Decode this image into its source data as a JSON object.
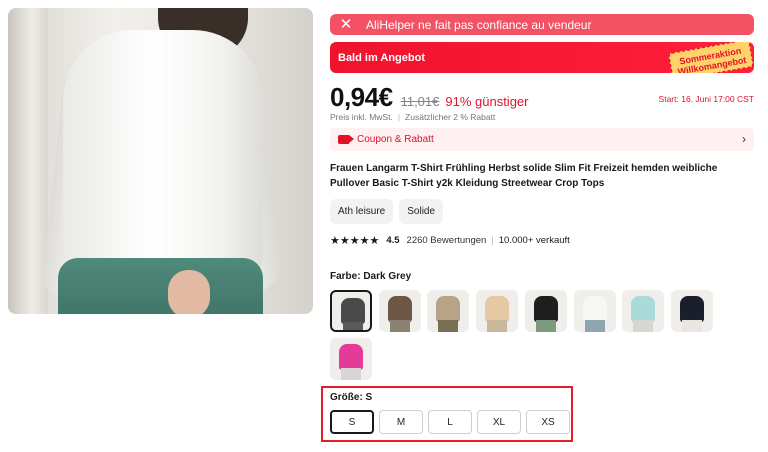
{
  "warning": {
    "icon": "close-icon",
    "text": "AliHelper ne fait pas confiance au vendeur",
    "color": "#f25264"
  },
  "deal": {
    "text": "Bald im Angebot",
    "badge": "Sommeraktion Willkomangebot",
    "color": "#f0132e"
  },
  "price": {
    "current": "0,94€",
    "original": "11,01€",
    "discount": "91% günstiger",
    "start": "Start: 16. Juni 17:00 CST"
  },
  "tax": {
    "incl": "Preis inkl. MwSt.",
    "extra": "Zusätzlicher 2 % Rabatt"
  },
  "coupon": {
    "icon": "tag-icon",
    "text": "Coupon & Rabatt",
    "chevron": "chevron-right-icon"
  },
  "product": {
    "title": "Frauen Langarm T-Shirt Frühling Herbst solide Slim Fit Freizeit hemden weibliche Pullover Basic T-Shirt y2k Kleidung Streetwear Crop Tops"
  },
  "chips": [
    "Ath leisure",
    "Solide"
  ],
  "rating": {
    "stars": 4.5,
    "stars_display": "★★★★★",
    "score": "4.5",
    "reviews": "2260 Bewertungen",
    "sold": "10.000+ verkauft"
  },
  "color": {
    "label": "Farbe: Dark Grey",
    "selected": 0,
    "swatches": [
      {
        "name": "Dark Grey",
        "shirt": "#4a4a4a",
        "pants": "#5a5a5a"
      },
      {
        "name": "Brown",
        "shirt": "#6e5646",
        "pants": "#8a8270"
      },
      {
        "name": "Khaki",
        "shirt": "#b7a487",
        "pants": "#7a6e55"
      },
      {
        "name": "Apricot",
        "shirt": "#e6c9a2",
        "pants": "#c9b79b"
      },
      {
        "name": "Black",
        "shirt": "#1e1e1e",
        "pants": "#7d9a7c"
      },
      {
        "name": "White",
        "shirt": "#f6f6f4",
        "pants": "#8fa6b0"
      },
      {
        "name": "Mint",
        "shirt": "#a9dcd8",
        "pants": "#d8d6d2"
      },
      {
        "name": "Navy",
        "shirt": "#1a1f2b",
        "pants": "#e9e6e0"
      },
      {
        "name": "Rose",
        "shirt": "#e63a9a",
        "pants": "#d9d5d5"
      }
    ]
  },
  "size": {
    "label": "Größe: S",
    "options": [
      "S",
      "M",
      "L",
      "XL",
      "XS"
    ],
    "selected": 0
  }
}
